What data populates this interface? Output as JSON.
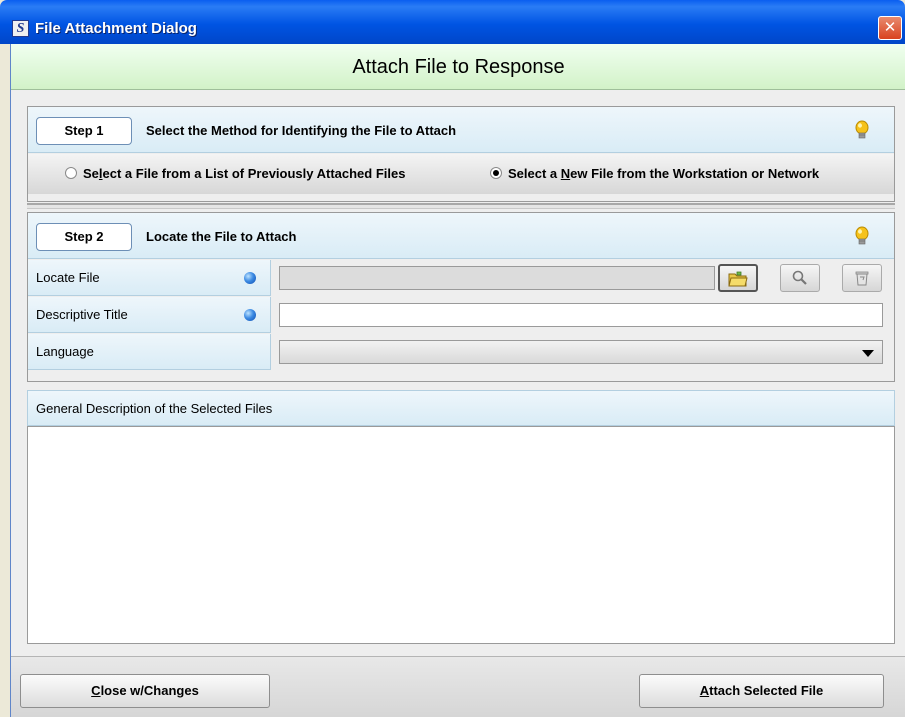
{
  "window": {
    "app_icon_letter": "S",
    "title": "File Attachment Dialog",
    "close_glyph": "✕"
  },
  "header": {
    "title": "Attach File to Response"
  },
  "step1": {
    "button_label": "Step 1",
    "title": "Select the Method for Identifying the File to Attach",
    "icon": "lightbulb-icon",
    "options": [
      {
        "pre": "Se",
        "mnemonic": "l",
        "post": "ect a File from a List of Previously Attached Files",
        "selected": false
      },
      {
        "pre": "Select a ",
        "mnemonic": "N",
        "post": "ew File from the Workstation or Network",
        "selected": true
      }
    ]
  },
  "step2": {
    "button_label": "Step 2",
    "title": "Locate the File to Attach",
    "icon": "lightbulb-icon",
    "fields": [
      {
        "label": "Locate File",
        "required": true,
        "value": ""
      },
      {
        "label": "Descriptive Title",
        "required": true,
        "value": ""
      },
      {
        "label": "Language",
        "required": false,
        "value": ""
      }
    ],
    "locate_buttons": [
      "open-folder-icon",
      "search-icon",
      "clear-icon"
    ]
  },
  "description": {
    "header": "General Description of the Selected Files",
    "value": ""
  },
  "footer": {
    "close_mnemonic": "C",
    "close_rest": "lose w/Changes",
    "attach_mnemonic": "A",
    "attach_rest": "ttach Selected File"
  },
  "colors": {
    "titlebar": "#0054e3",
    "header_green": "#d2f2c8",
    "step_blue": "#d9ecf6",
    "required_dot": "#3d8be3"
  }
}
